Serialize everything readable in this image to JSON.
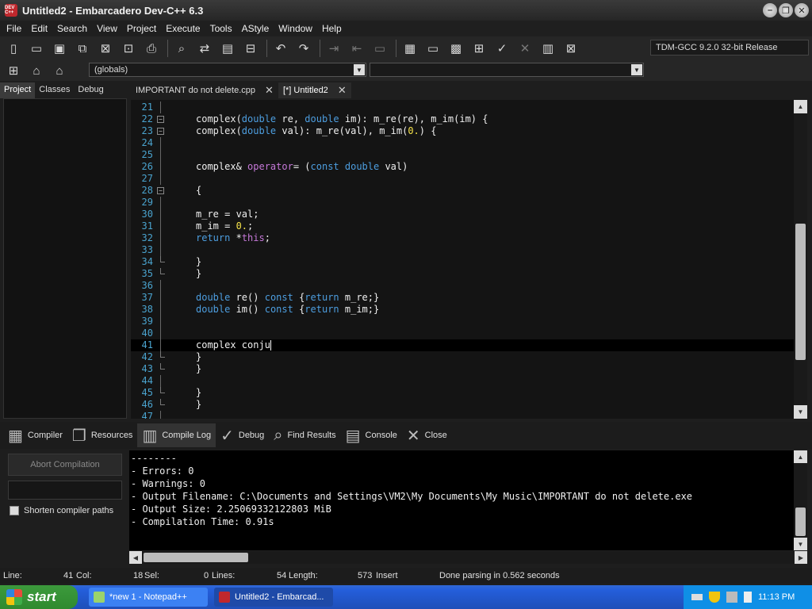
{
  "window": {
    "title": "Untitled2 - Embarcadero Dev-C++ 6.3",
    "logo_text": "DEV C++"
  },
  "menu": [
    "File",
    "Edit",
    "Search",
    "View",
    "Project",
    "Execute",
    "Tools",
    "AStyle",
    "Window",
    "Help"
  ],
  "toolbar": {
    "compiler": "TDM-GCC 9.2.0 32-bit Release",
    "scope": "(globals)"
  },
  "left_tabs": [
    "Project",
    "Classes",
    "Debug"
  ],
  "editor_tabs": [
    {
      "label": "IMPORTANT do not delete.cpp",
      "active": false
    },
    {
      "label": "[*] Untitled2",
      "active": true
    }
  ],
  "code_lines": [
    {
      "n": "21",
      "fold": "line",
      "html": ""
    },
    {
      "n": "22",
      "fold": "box",
      "html": "<span class=\"fn\">complex(</span><span class=\"kw\">double</span> re, <span class=\"kw\">double</span> im): m_re(re), m_im(im) {"
    },
    {
      "n": "23",
      "fold": "box",
      "html": "<span class=\"fn\">complex(</span><span class=\"kw\">double</span> val): m_re(val), m_im(<span class=\"num\">0.</span>) {"
    },
    {
      "n": "24",
      "fold": "line",
      "html": ""
    },
    {
      "n": "25",
      "fold": "line",
      "html": ""
    },
    {
      "n": "26",
      "fold": "line",
      "html": "complex&amp; <span class=\"kwop\">operator</span>= (<span class=\"kw\">const</span> <span class=\"kw\">double</span> val)"
    },
    {
      "n": "27",
      "fold": "line",
      "html": ""
    },
    {
      "n": "28",
      "fold": "box",
      "html": "{"
    },
    {
      "n": "29",
      "fold": "line",
      "html": ""
    },
    {
      "n": "30",
      "fold": "line",
      "html": "m_re = val;"
    },
    {
      "n": "31",
      "fold": "line",
      "html": "m_im = <span class=\"num\">0.</span>;"
    },
    {
      "n": "32",
      "fold": "line",
      "html": "<span class=\"kw\">return</span> *<span class=\"kwop\">this</span>;"
    },
    {
      "n": "33",
      "fold": "line",
      "html": ""
    },
    {
      "n": "34",
      "fold": "end",
      "html": "}"
    },
    {
      "n": "35",
      "fold": "end",
      "html": "}"
    },
    {
      "n": "36",
      "fold": "line",
      "html": ""
    },
    {
      "n": "37",
      "fold": "line",
      "html": "<span class=\"kw\">double</span> re() <span class=\"kw\">const</span> {<span class=\"kw\">return</span> m_re;}"
    },
    {
      "n": "38",
      "fold": "line",
      "html": "<span class=\"kw\">double</span> im() <span class=\"kw\">const</span> {<span class=\"kw\">return</span> m_im;}"
    },
    {
      "n": "39",
      "fold": "line",
      "html": ""
    },
    {
      "n": "40",
      "fold": "line",
      "html": ""
    },
    {
      "n": "41",
      "fold": "line",
      "current": true,
      "html": "complex conju<span class=\"caret\"></span>"
    },
    {
      "n": "42",
      "fold": "end",
      "html": "}"
    },
    {
      "n": "43",
      "fold": "end",
      "html": "}"
    },
    {
      "n": "44",
      "fold": "line",
      "html": ""
    },
    {
      "n": "45",
      "fold": "end",
      "html": "}"
    },
    {
      "n": "46",
      "fold": "end",
      "html": "}"
    },
    {
      "n": "47",
      "fold": "line",
      "html": ""
    }
  ],
  "bottom_tabs": [
    {
      "label": "Compiler",
      "icon": "grid-icon",
      "glyph": "▦"
    },
    {
      "label": "Resources",
      "icon": "copy-icon",
      "glyph": "❐"
    },
    {
      "label": "Compile Log",
      "icon": "bar-chart-icon",
      "glyph": "▥",
      "active": true
    },
    {
      "label": "Debug",
      "icon": "check-icon",
      "glyph": "✓"
    },
    {
      "label": "Find Results",
      "icon": "find-icon",
      "glyph": "⌕"
    },
    {
      "label": "Console",
      "icon": "console-icon",
      "glyph": "▤"
    },
    {
      "label": "Close",
      "icon": "close-icon",
      "glyph": "✕"
    }
  ],
  "compile_panel": {
    "abort_label": "Abort Compilation",
    "shorten_label": "Shorten compiler paths",
    "log": [
      "--------",
      "- Errors: 0",
      "- Warnings: 0",
      "- Output Filename: C:\\Documents and Settings\\VM2\\My Documents\\My Music\\IMPORTANT do not delete.exe",
      "- Output Size: 2.25069332122803 MiB",
      "- Compilation Time: 0.91s"
    ]
  },
  "status": {
    "line_label": "Line:",
    "line": "41",
    "col_label": "Col:",
    "col": "18",
    "sel_label": "Sel:",
    "sel": "0",
    "lines_label": "Lines:",
    "lines": "54",
    "length_label": "Length:",
    "length": "573",
    "mode": "Insert",
    "message": "Done parsing in 0.562 seconds"
  },
  "taskbar": {
    "start_label": "start",
    "tasks": [
      {
        "label": "*new 1 - Notepad++"
      },
      {
        "label": "Untitled2 - Embarcad..."
      }
    ],
    "clock": "11:13 PM"
  }
}
